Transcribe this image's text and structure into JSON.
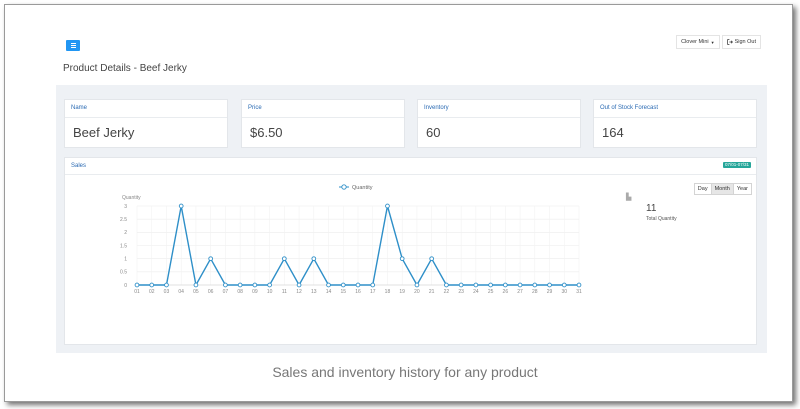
{
  "header": {
    "user_label": "Clover Mini",
    "signout_label": "Sign Out"
  },
  "page": {
    "title": "Product Details - Beef Jerky"
  },
  "cards": [
    {
      "label": "Name",
      "value": "Beef Jerky"
    },
    {
      "label": "Price",
      "value": "$6.50"
    },
    {
      "label": "Inventory",
      "value": "60"
    },
    {
      "label": "Out of Stock Forecast",
      "value": "164"
    }
  ],
  "sales": {
    "title": "Sales",
    "date_badge": "07/01-07/31",
    "ranges": [
      "Day",
      "Month",
      "Year"
    ],
    "active_range": "Month",
    "total_value": "11",
    "total_label": "Total Quantity"
  },
  "chart_data": {
    "type": "line",
    "title": "",
    "ylabel": "Quantity",
    "xlabel": "",
    "ylim": [
      0,
      3
    ],
    "yticks": [
      "0",
      "0.5",
      "1",
      "1.5",
      "2",
      "2.5",
      "3"
    ],
    "grid": true,
    "legend_position": "top",
    "categories": [
      "01",
      "02",
      "03",
      "04",
      "05",
      "06",
      "07",
      "08",
      "09",
      "10",
      "11",
      "12",
      "13",
      "14",
      "15",
      "16",
      "17",
      "18",
      "19",
      "20",
      "21",
      "22",
      "23",
      "24",
      "25",
      "26",
      "27",
      "28",
      "29",
      "30",
      "31"
    ],
    "series": [
      {
        "name": "Quantity",
        "color": "#2e8fc8",
        "values": [
          0,
          0,
          0,
          3,
          0,
          1,
          0,
          0,
          0,
          0,
          1,
          0,
          1,
          0,
          0,
          0,
          0,
          3,
          1,
          0,
          1,
          0,
          0,
          0,
          0,
          0,
          0,
          0,
          0,
          0,
          0
        ]
      }
    ]
  },
  "caption": "Sales and inventory history for any product"
}
